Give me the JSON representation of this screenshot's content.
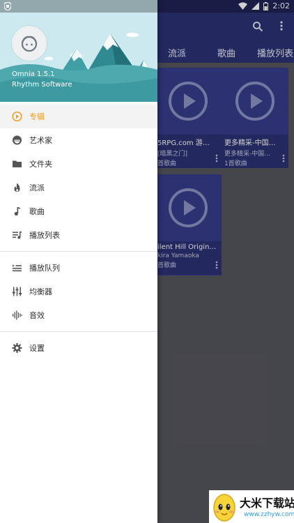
{
  "status_bar": {
    "time": "2:02"
  },
  "app_bar": {
    "search_icon": "search-icon",
    "more_icon": "more-vert-icon"
  },
  "tabs": [
    "流派",
    "歌曲",
    "播放列表"
  ],
  "albums": [
    {
      "line1": "5RPG.com 游…",
      "line2": "[暗黑之门]",
      "line3": "首歌曲"
    },
    {
      "line1": "更多精采-中国…",
      "line2": "更多精采-中国…",
      "line3": "1首歌曲"
    },
    {
      "line1": "ilent Hill Origin…",
      "line2": "kira Yamaoka",
      "line3": "首歌曲"
    }
  ],
  "drawer": {
    "app_name": "Omnia 1.5.1",
    "vendor": "Rhythm Software",
    "accent_color": "#f39a1e",
    "menu": [
      {
        "id": "albums",
        "label": "专辑",
        "icon": "album-icon",
        "active": true
      },
      {
        "id": "artists",
        "label": "艺术家",
        "icon": "artist-icon",
        "active": false
      },
      {
        "id": "folders",
        "label": "文件夹",
        "icon": "folder-icon",
        "active": false
      },
      {
        "id": "genres",
        "label": "流派",
        "icon": "genre-flame-icon",
        "active": false
      },
      {
        "id": "songs",
        "label": "歌曲",
        "icon": "music-note-icon",
        "active": false
      },
      {
        "id": "playlists",
        "label": "播放列表",
        "icon": "playlist-icon",
        "active": false
      }
    ],
    "menu2": [
      {
        "id": "queue",
        "label": "播放队列",
        "icon": "queue-icon"
      },
      {
        "id": "equalizer",
        "label": "均衡器",
        "icon": "equalizer-icon"
      },
      {
        "id": "effects",
        "label": "音效",
        "icon": "sound-wave-icon"
      }
    ],
    "menu3": [
      {
        "id": "settings",
        "label": "设置",
        "icon": "gear-icon"
      }
    ]
  },
  "watermark": {
    "title": "大米下载站",
    "url": "www.zzhyw.com"
  }
}
